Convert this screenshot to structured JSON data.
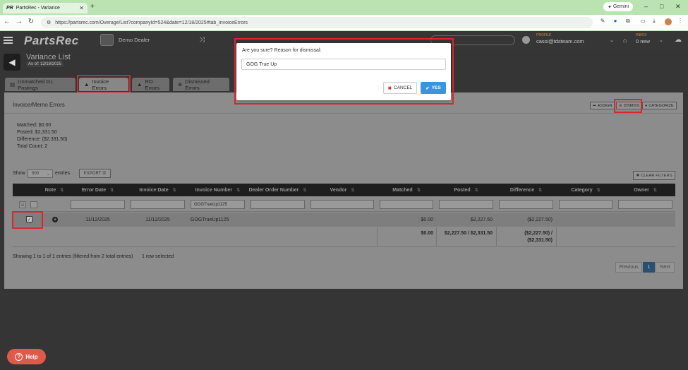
{
  "browser": {
    "tab_title": "PartsRec - Variance",
    "tab_favicon": "PR",
    "new_tab": "+",
    "gemini_label": "Gemini",
    "url": "https://partsrec.com/Overage/List?companyId=524&date=12/18/2025#tab_invoiceErrors",
    "window_controls": [
      "–",
      "□",
      "✕"
    ]
  },
  "app": {
    "logo": "PartsRec",
    "dealer": "Demo Dealer",
    "profile_label": "PROFILE",
    "profile_name": "cassi@tdsteam.com",
    "inbox_label": "INBOX",
    "inbox_value": "0 new"
  },
  "page": {
    "title": "Variance List",
    "as_of": "As of: 12/18/2025",
    "tabs": [
      {
        "label": "Unmatched GL Postings",
        "icon": "list-icon"
      },
      {
        "label": "Invoice Errors",
        "icon": "warning-icon"
      },
      {
        "label": "RO Errors",
        "icon": "warning-icon"
      },
      {
        "label": "Dismissed Errors",
        "icon": "circle-x-icon"
      }
    ],
    "active_tab": "Invoice Errors"
  },
  "panel": {
    "title": "Invoice/Memo Errors",
    "actions": {
      "assign": "ASSIGN",
      "dismiss": "DISMISS",
      "categorize": "CATEGORIZE"
    },
    "summary": {
      "matched": "Matched: $0.00",
      "posted": "Posted: $2,331.50",
      "difference": "Difference: ($2,331.50)",
      "total_count": "Total Count: 2"
    },
    "show_label": "Show",
    "page_size": "500",
    "entries_label": "entries",
    "export": "EXPORT",
    "clear_filters": "CLEAR FILTERS"
  },
  "table": {
    "columns": [
      "Note",
      "Error Date",
      "Invoice Date",
      "Invoice Number",
      "Dealer Order Number",
      "Vendor",
      "Matched",
      "Posted",
      "Difference",
      "Category",
      "Owner"
    ],
    "filter_invoice_number": "GOGTrueUp1125",
    "row": {
      "error_date": "11/12/2025",
      "invoice_date": "11/12/2025",
      "invoice_number": "GOGTrueUp1125",
      "matched": "$0.00",
      "posted": "$2,227.50",
      "difference": "($2,227.50)"
    },
    "totals": {
      "matched": "$0.00",
      "posted": "$2,227.50 / $2,331.50",
      "difference_line1": "($2,227.50) /",
      "difference_line2": "($2,331.50)"
    },
    "info": "Showing 1 to 1 of 1 entries (filtered from 2 total entries)",
    "selected": "1 row selected",
    "pagination": {
      "previous": "Previous",
      "current": "1",
      "next": "Next"
    }
  },
  "modal": {
    "question": "Are you sure? Reason for dismissal:",
    "reason_value": "GOG True Up",
    "cancel": "CANCEL",
    "yes": "YES"
  },
  "help": "Help",
  "colors": {
    "browser_chrome": "#b9e3b1",
    "accent": "#3a94e0",
    "highlight": "#d9262c",
    "help": "#e05a4a"
  }
}
